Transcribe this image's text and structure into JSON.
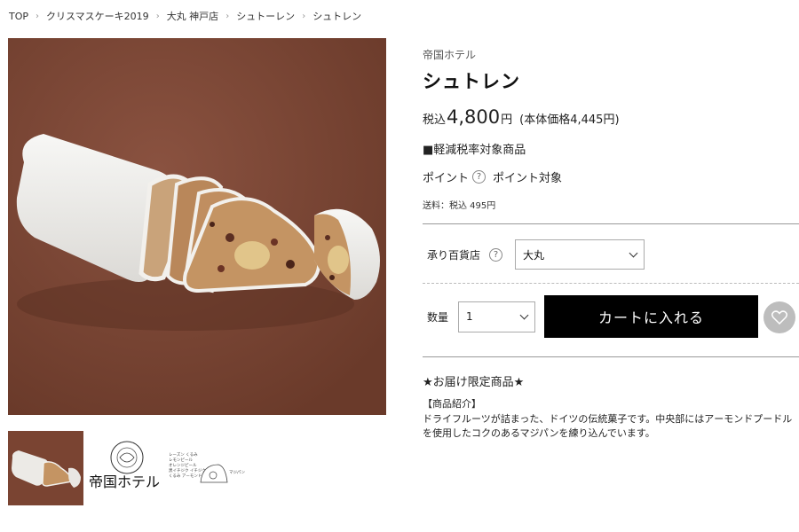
{
  "breadcrumb": {
    "items": [
      "TOP",
      "クリスマスケーキ2019",
      "大丸 神戸店",
      "シュトーレン"
    ],
    "current": "シュトレン"
  },
  "product": {
    "brand": "帝国ホテル",
    "name": "シュトレン",
    "price_prefix": "税込",
    "price_value": "4,800",
    "price_suffix": "円",
    "price_net": "(本体価格4,445円)",
    "reduced_tax": "■軽減税率対象商品",
    "points_label": "ポイント",
    "points_value": "ポイント対象",
    "shipping": "送料：税込 495円"
  },
  "store": {
    "label": "承り百貨店",
    "selected": "大丸"
  },
  "quantity": {
    "label": "数量",
    "selected": "1"
  },
  "cart_button": "カートに入れる",
  "description": {
    "limited": "★お届け限定商品★",
    "intro_title": "【商品紹介】",
    "intro_body": "ドライフルーツが詰まった、ドイツの伝統菓子です。中央部にはアーモンドプードルを使用したコクのあるマジパンを練り込んでいます。"
  },
  "thumbnails": {
    "logo_text": "帝国ホテル",
    "diagram_text": "レーズン くるみ レモンピール オレンジピール 黒イチジク イチジク くるみ アーモンド マジパン"
  },
  "icons": {
    "help": "question-circle-icon",
    "dropdown": "chevron-down-icon",
    "favorite": "heart-icon",
    "separator": "chevron-right-icon"
  },
  "colors": {
    "background_photo": "#7a4432",
    "cart_button": "#000000",
    "favorite_button": "#bdbdbd"
  }
}
